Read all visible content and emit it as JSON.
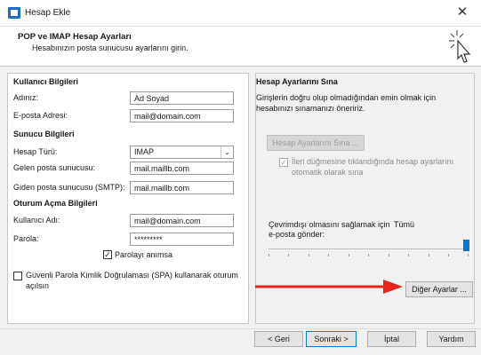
{
  "window": {
    "title": "Hesap Ekle",
    "close_glyph": "✕"
  },
  "header": {
    "title": "POP ve IMAP Hesap Ayarları",
    "subtitle": "Hesabınızın posta sunucusu ayarlarını girin.",
    "icon": "wand-cursor-icon"
  },
  "user_info": {
    "section_title": "Kullanıcı Bilgileri",
    "name_label": "Adınız:",
    "name_value": "Ad Soyad",
    "email_label": "E-posta Adresi:",
    "email_value": "mail@domain.com"
  },
  "server_info": {
    "section_title": "Sunucu Bilgileri",
    "account_type_label": "Hesap Türü:",
    "account_type_value": "IMAP",
    "incoming_label": "Gelen posta sunucusu:",
    "incoming_value": "mail.maillb.com",
    "outgoing_label": "Giden posta sunucusu (SMTP):",
    "outgoing_value": "mail.maillb.com"
  },
  "login_info": {
    "section_title": "Oturum Açma Bilgileri",
    "username_label": "Kullanıcı Adı:",
    "username_value": "mail@domain.com",
    "password_label": "Parola:",
    "password_value": "*********",
    "remember_label": "Parolayı anımsa",
    "remember_checked": true,
    "spa_label_line1": "Güvenli Parola Kimlik Doğrulaması (SPA) kullanarak oturum",
    "spa_label_line2": "açılsın",
    "spa_checked": false
  },
  "test_settings": {
    "section_title": "Hesap Ayarlarını Sına",
    "description_line1": "Girişlerin doğru olup olmadığından emin olmak için",
    "description_line2": "hesabınızı sınamanızı öneririz.",
    "test_button": "Hesap Ayarlarını Sına ...",
    "auto_test_label_line1": "İleri düğmesine tıklandığında hesap ayarlarını",
    "auto_test_label_line2": "otomatik olarak sına",
    "auto_test_checked": true
  },
  "offline": {
    "label_line1": "Çevrimdışı olmasını sağlamak için",
    "label_line1_value": "Tümü",
    "label_line2": "e-posta gönder:",
    "slider_level": 1.0
  },
  "more_settings_button": "Diğer Ayarlar ...",
  "annotation_arrow_color": "#e8231e",
  "footer": {
    "back": "< Geri",
    "next": "Sonraki >",
    "cancel": "İptal",
    "help": "Yardım"
  }
}
